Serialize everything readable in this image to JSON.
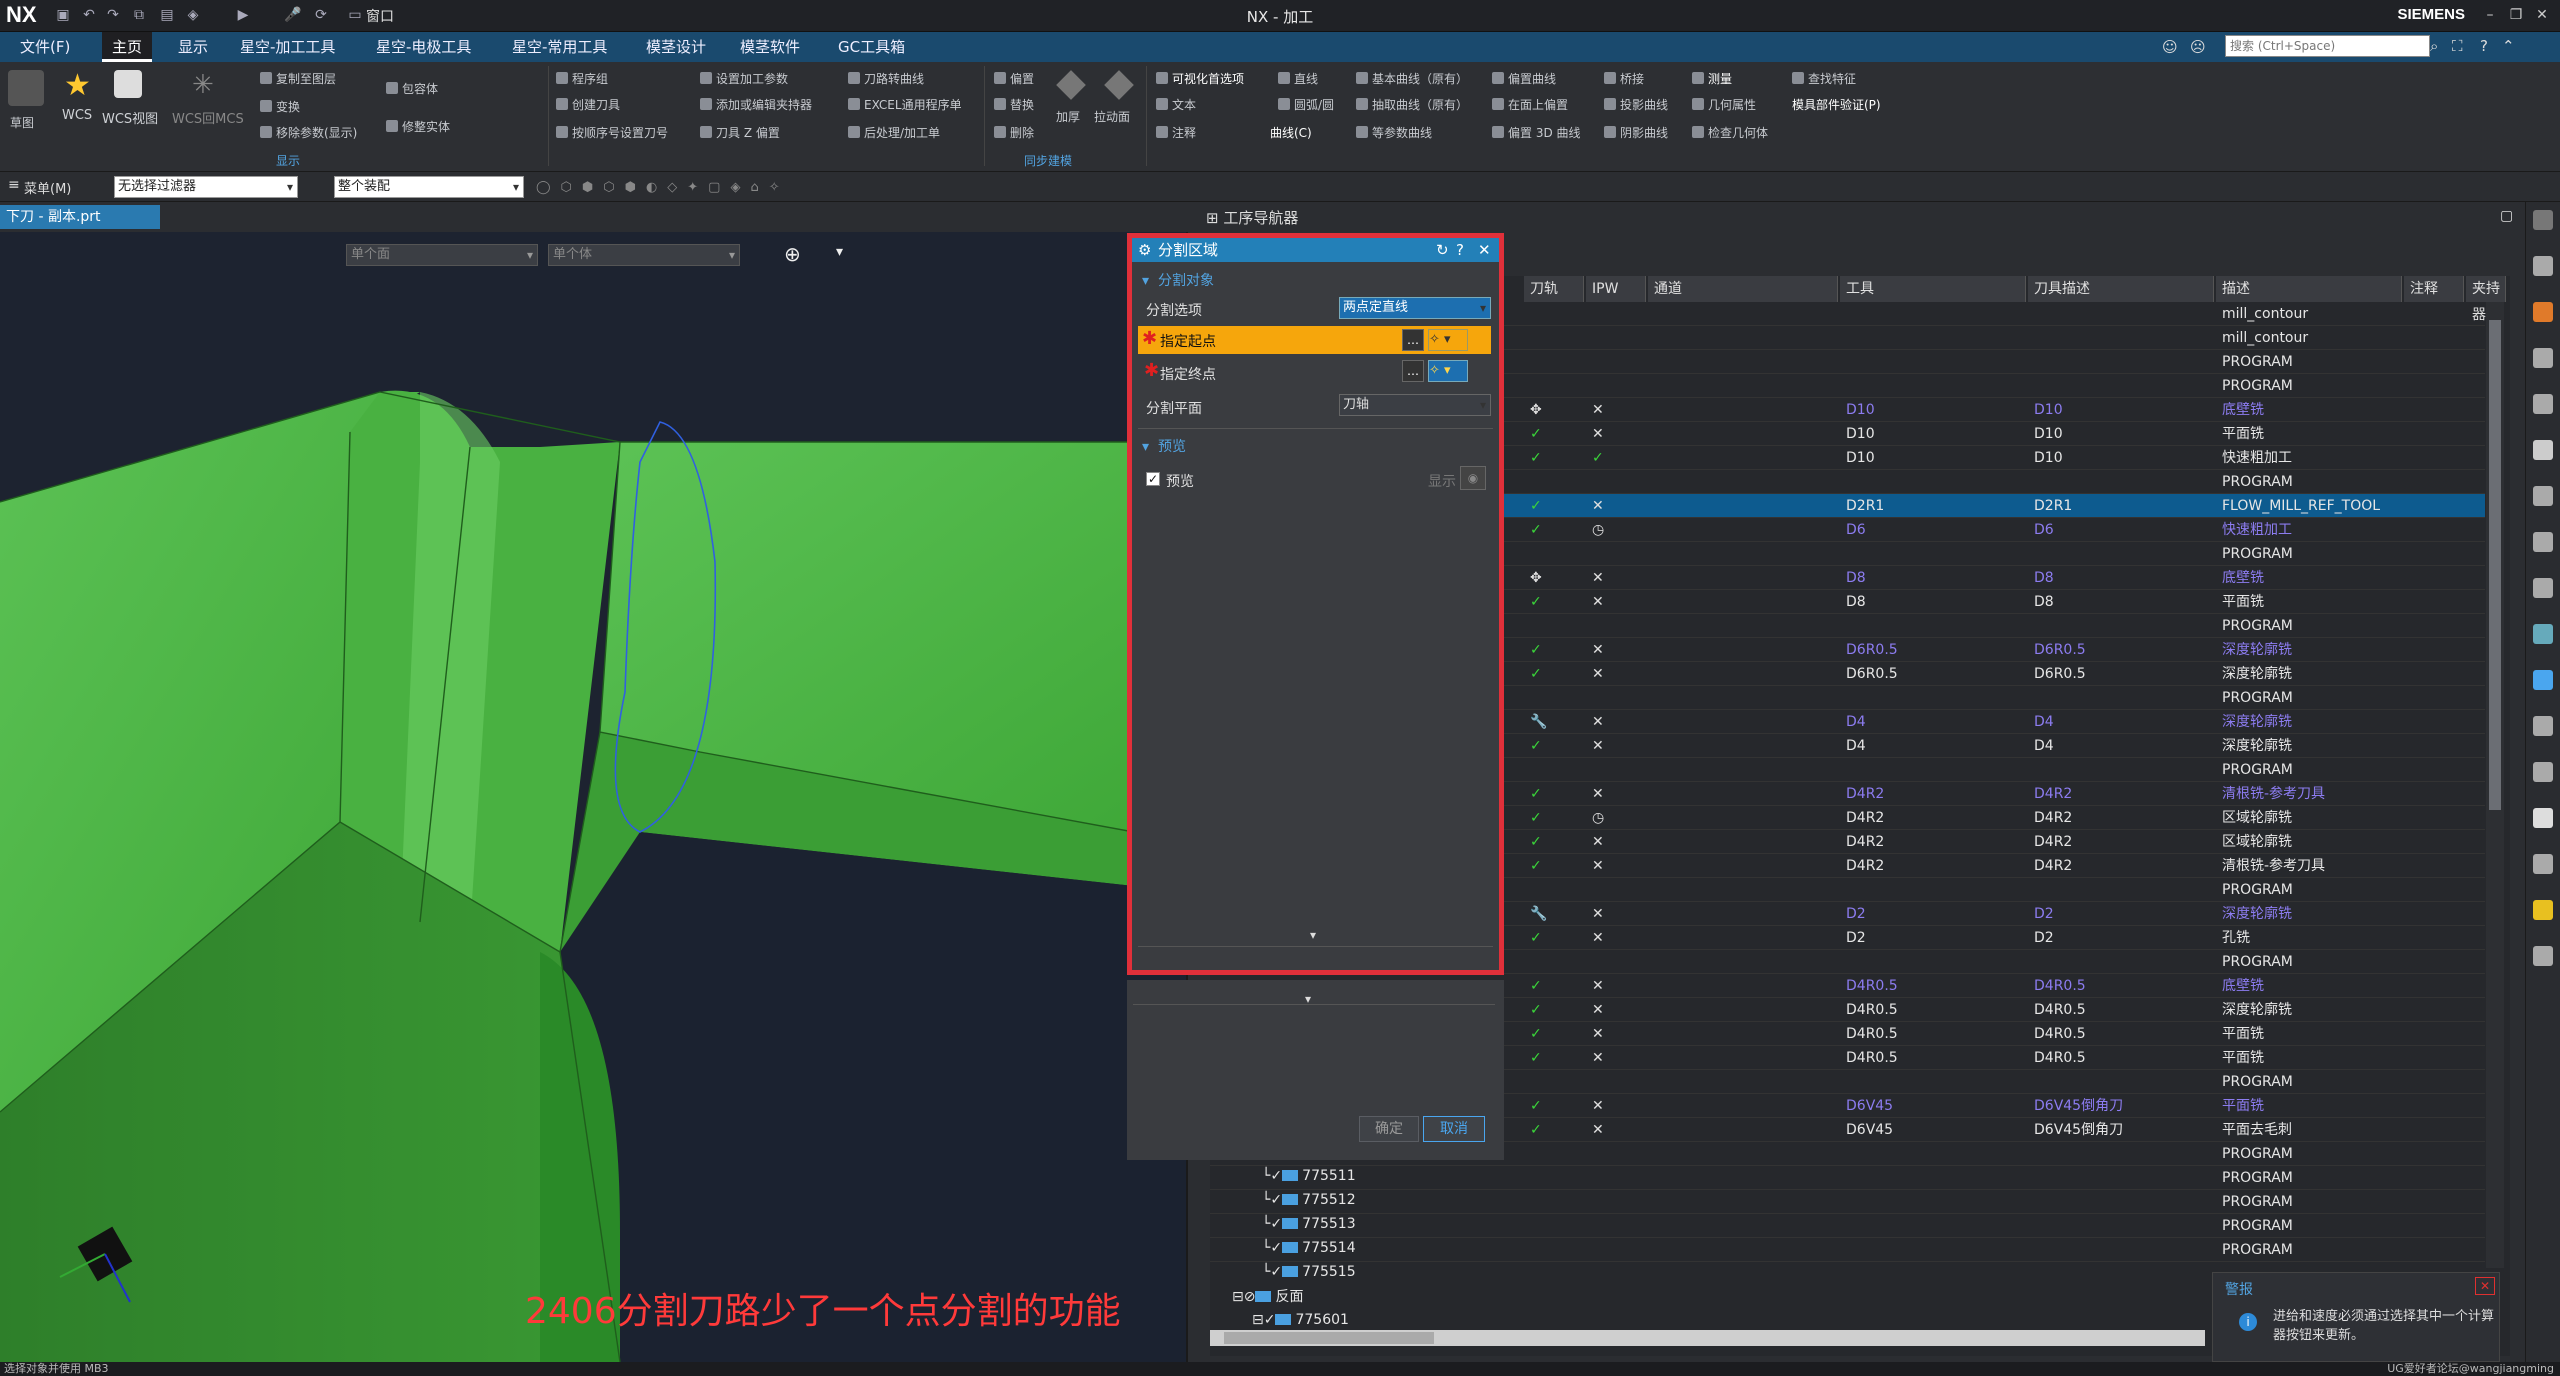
{
  "titlebar": {
    "logo": "NX",
    "title": "NX - 加工",
    "brand": "SIEMENS",
    "window_menu": "窗口",
    "search_placeholder": "搜索 (Ctrl+Space)"
  },
  "menu": {
    "file": "文件(F)",
    "tabs": [
      "主页",
      "显示",
      "星空-加工工具",
      "星空-电极工具",
      "星空-常用工具",
      "模茎设计",
      "模茎软件",
      "GC工具箱"
    ],
    "active_tab": "主页"
  },
  "ribbon": {
    "sketch": "草图",
    "wcs": "WCS",
    "wcs_view": "WCS视图",
    "wcs_mcs": "WCS回MCS",
    "copy_layer": "复制至图层",
    "transform": "变换",
    "move_params": "移除参数(显示)",
    "bounding_body": "包容体",
    "trim_body": "修整实体",
    "display_group": "显示",
    "program_group": "程序组",
    "create_tool": "创建刀具",
    "order_tool": "按顺序号设置刀号",
    "set_params": "设置加工参数",
    "add_holder": "添加或编辑夹持器",
    "tool_z_offset": "刀具 Z 偏置",
    "tool_curve": "刀路转曲线",
    "excel_list": "EXCEL通用程序单",
    "post_process": "后处理/加工单",
    "offset": "偏置",
    "replace": "替换",
    "delete": "删除",
    "thicken": "加厚",
    "pull": "拉动面",
    "sync_group": "同步建模",
    "visual_pref": "可视化首选项",
    "text": "文本",
    "annotation": "注释",
    "line": "直线",
    "arc": "圆弧/圆",
    "curve": "曲线(C)",
    "basic_curve": "基本曲线（原有）",
    "extract_curve": "抽取曲线（原有）",
    "iso_curve": "等参数曲线",
    "offset_curve": "偏置曲线",
    "offset_on_face": "在面上偏置",
    "offset_3d": "偏置 3D 曲线",
    "bridge": "桥接",
    "project_curve": "投影曲线",
    "shadow_curve": "阴影曲线",
    "measure": "测量",
    "geom_props": "几何属性",
    "check_geom": "检查几何体",
    "find_feature": "查找特征",
    "mold_verify": "模具部件验证(P)"
  },
  "bar2": {
    "menu": "菜单(M)",
    "filter": "无选择过滤器",
    "assembly": "整个装配"
  },
  "file_tab": "下刀 - 副本.prt",
  "viewport": {
    "face_filter": "单个面",
    "body_filter": "单个体",
    "caption": "2406分割刀路少了一个点分割的功能"
  },
  "navigator": {
    "title": "工序导航器",
    "columns": [
      "刀轨",
      "IPW",
      "通道",
      "工具",
      "刀具描述",
      "描述",
      "注释",
      "夹持器"
    ],
    "rows": [
      {
        "path": "",
        "ipw": "",
        "tool": "",
        "tdesc": "",
        "desc": "mill_contour",
        "purple": false
      },
      {
        "path": "",
        "ipw": "",
        "tool": "",
        "tdesc": "",
        "desc": "mill_contour",
        "purple": false
      },
      {
        "path": "",
        "ipw": "",
        "tool": "",
        "tdesc": "",
        "desc": "PROGRAM",
        "purple": false
      },
      {
        "path": "",
        "ipw": "",
        "tool": "",
        "tdesc": "",
        "desc": "PROGRAM",
        "purple": false
      },
      {
        "path": "move",
        "ipw": "x",
        "tool": "D10",
        "tdesc": "D10",
        "desc": "底壁铣",
        "purple": true
      },
      {
        "path": "check",
        "ipw": "x",
        "tool": "D10",
        "tdesc": "D10",
        "desc": "平面铣",
        "purple": false
      },
      {
        "path": "check",
        "ipw": "check",
        "tool": "D10",
        "tdesc": "D10",
        "desc": "快速粗加工",
        "purple": false
      },
      {
        "path": "",
        "ipw": "",
        "tool": "",
        "tdesc": "",
        "desc": "PROGRAM",
        "purple": false
      },
      {
        "path": "check",
        "ipw": "x",
        "tool": "D2R1",
        "tdesc": "D2R1",
        "desc": "FLOW_MILL_REF_TOOL",
        "purple": false,
        "selected": true
      },
      {
        "path": "check",
        "ipw": "clock",
        "tool": "D6",
        "tdesc": "D6",
        "desc": "快速粗加工",
        "purple": true
      },
      {
        "path": "",
        "ipw": "",
        "tool": "",
        "tdesc": "",
        "desc": "PROGRAM",
        "purple": false
      },
      {
        "path": "move",
        "ipw": "x",
        "tool": "D8",
        "tdesc": "D8",
        "desc": "底壁铣",
        "purple": true
      },
      {
        "path": "check",
        "ipw": "x",
        "tool": "D8",
        "tdesc": "D8",
        "desc": "平面铣",
        "purple": false
      },
      {
        "path": "",
        "ipw": "",
        "tool": "",
        "tdesc": "",
        "desc": "PROGRAM",
        "purple": false
      },
      {
        "path": "check",
        "ipw": "x",
        "tool": "D6R0.5",
        "tdesc": "D6R0.5",
        "desc": "深度轮廓铣",
        "purple": true
      },
      {
        "path": "check",
        "ipw": "x",
        "tool": "D6R0.5",
        "tdesc": "D6R0.5",
        "desc": "深度轮廓铣",
        "purple": false
      },
      {
        "path": "",
        "ipw": "",
        "tool": "",
        "tdesc": "",
        "desc": "PROGRAM",
        "purple": false
      },
      {
        "path": "wrench",
        "ipw": "x",
        "tool": "D4",
        "tdesc": "D4",
        "desc": "深度轮廓铣",
        "purple": true
      },
      {
        "path": "check",
        "ipw": "x",
        "tool": "D4",
        "tdesc": "D4",
        "desc": "深度轮廓铣",
        "purple": false
      },
      {
        "path": "",
        "ipw": "",
        "tool": "",
        "tdesc": "",
        "desc": "PROGRAM",
        "purple": false
      },
      {
        "path": "check",
        "ipw": "x",
        "tool": "D4R2",
        "tdesc": "D4R2",
        "desc": "清根铣-参考刀具",
        "purple": true
      },
      {
        "path": "check",
        "ipw": "clock",
        "tool": "D4R2",
        "tdesc": "D4R2",
        "desc": "区域轮廓铣",
        "purple": false
      },
      {
        "path": "check",
        "ipw": "x",
        "tool": "D4R2",
        "tdesc": "D4R2",
        "desc": "区域轮廓铣",
        "purple": false
      },
      {
        "path": "check",
        "ipw": "x",
        "tool": "D4R2",
        "tdesc": "D4R2",
        "desc": "清根铣-参考刀具",
        "purple": false
      },
      {
        "path": "",
        "ipw": "",
        "tool": "",
        "tdesc": "",
        "desc": "PROGRAM",
        "purple": false
      },
      {
        "path": "wrench",
        "ipw": "x",
        "tool": "D2",
        "tdesc": "D2",
        "desc": "深度轮廓铣",
        "purple": true
      },
      {
        "path": "check",
        "ipw": "x",
        "tool": "D2",
        "tdesc": "D2",
        "desc": "孔铣",
        "purple": false
      },
      {
        "path": "",
        "ipw": "",
        "tool": "",
        "tdesc": "",
        "desc": "PROGRAM",
        "purple": false
      },
      {
        "path": "check",
        "ipw": "x",
        "tool": "D4R0.5",
        "tdesc": "D4R0.5",
        "desc": "底壁铣",
        "purple": true
      },
      {
        "path": "check",
        "ipw": "x",
        "tool": "D4R0.5",
        "tdesc": "D4R0.5",
        "desc": "深度轮廓铣",
        "purple": false
      },
      {
        "path": "check",
        "ipw": "x",
        "tool": "D4R0.5",
        "tdesc": "D4R0.5",
        "desc": "平面铣",
        "purple": false
      },
      {
        "path": "check",
        "ipw": "x",
        "tool": "D4R0.5",
        "tdesc": "D4R0.5",
        "desc": "平面铣",
        "purple": false
      },
      {
        "path": "",
        "ipw": "",
        "tool": "",
        "tdesc": "",
        "desc": "PROGRAM",
        "purple": false
      },
      {
        "path": "check",
        "ipw": "x",
        "tool": "D6V45",
        "tdesc": "D6V45倒角刀",
        "desc": "平面铣",
        "purple": true
      },
      {
        "path": "check",
        "ipw": "x",
        "tool": "D6V45",
        "tdesc": "D6V45倒角刀",
        "desc": "平面去毛刺",
        "purple": false
      },
      {
        "path": "",
        "ipw": "",
        "tool": "",
        "tdesc": "",
        "desc": "PROGRAM",
        "purple": false
      },
      {
        "path": "",
        "ipw": "",
        "tool": "",
        "tdesc": "",
        "desc": "PROGRAM",
        "purple": false
      },
      {
        "path": "",
        "ipw": "",
        "tool": "",
        "tdesc": "",
        "desc": "PROGRAM",
        "purple": false
      },
      {
        "path": "",
        "ipw": "",
        "tool": "",
        "tdesc": "",
        "desc": "PROGRAM",
        "purple": false
      },
      {
        "path": "",
        "ipw": "",
        "tool": "",
        "tdesc": "",
        "desc": "PROGRAM",
        "purple": false
      }
    ],
    "tree_items": [
      "775511",
      "775512",
      "775513",
      "775514",
      "775515"
    ],
    "tree_group": "反面",
    "tree_sub": "775601"
  },
  "dialog": {
    "title": "分割区域",
    "section_object": "分割对象",
    "split_option_label": "分割选项",
    "split_option_value": "两点定直线",
    "start_point": "指定起点",
    "end_point": "指定终点",
    "split_plane_label": "分割平面",
    "split_plane_value": "刀轴",
    "section_preview": "预览",
    "preview_checkbox": "预览",
    "show_button": "显示",
    "ok": "确定",
    "cancel": "取消"
  },
  "alert": {
    "title": "警报",
    "message": "进给和速度必须通过选择其中一个计算器按钮来更新。"
  },
  "status": {
    "left": "选择对象并使用 MB3",
    "watermark": "UG爱好者论坛@wangjiangming"
  },
  "colors": {
    "accent": "#2380b8",
    "highlight_red": "#e0303a",
    "model_green": "#3faa3a",
    "selected_row": "#0d5b8f",
    "purple_text": "#8c7cf0"
  }
}
